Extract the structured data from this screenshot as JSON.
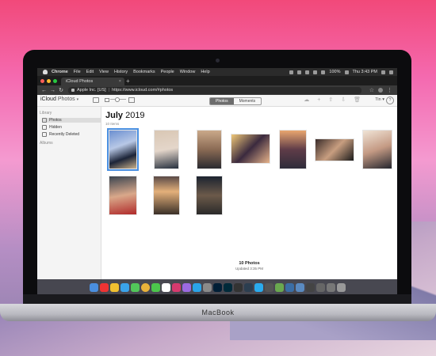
{
  "menubar": {
    "items": [
      "Chrome",
      "File",
      "Edit",
      "View",
      "History",
      "Bookmarks",
      "People",
      "Window",
      "Help"
    ],
    "battery": "100%",
    "clock": "Thu 3:43 PM"
  },
  "browser": {
    "tab_title": "iCloud Photos",
    "address_org": "Apple Inc. [US]",
    "address_url": "https://www.icloud.com/#photos"
  },
  "toolbar": {
    "app_name": "iCloud",
    "app_section": "Photos",
    "seg_photos": "Photos",
    "seg_moments": "Moments",
    "user": "Tin",
    "help": "?"
  },
  "sidebar": {
    "library_header": "Library",
    "items": [
      "Photos",
      "Hidden",
      "Recently Deleted"
    ],
    "albums_header": "Albums"
  },
  "content": {
    "month": "July",
    "year": "2019",
    "item_count": "10 Items",
    "footer_title": "10 Photos",
    "footer_sub": "Updated 3:35 PM"
  },
  "laptop": {
    "brand": "MacBook"
  },
  "colors": {
    "selection": "#4a90e2",
    "menubar": "#2b2b2b",
    "sidebar": "#f4f4f4"
  }
}
